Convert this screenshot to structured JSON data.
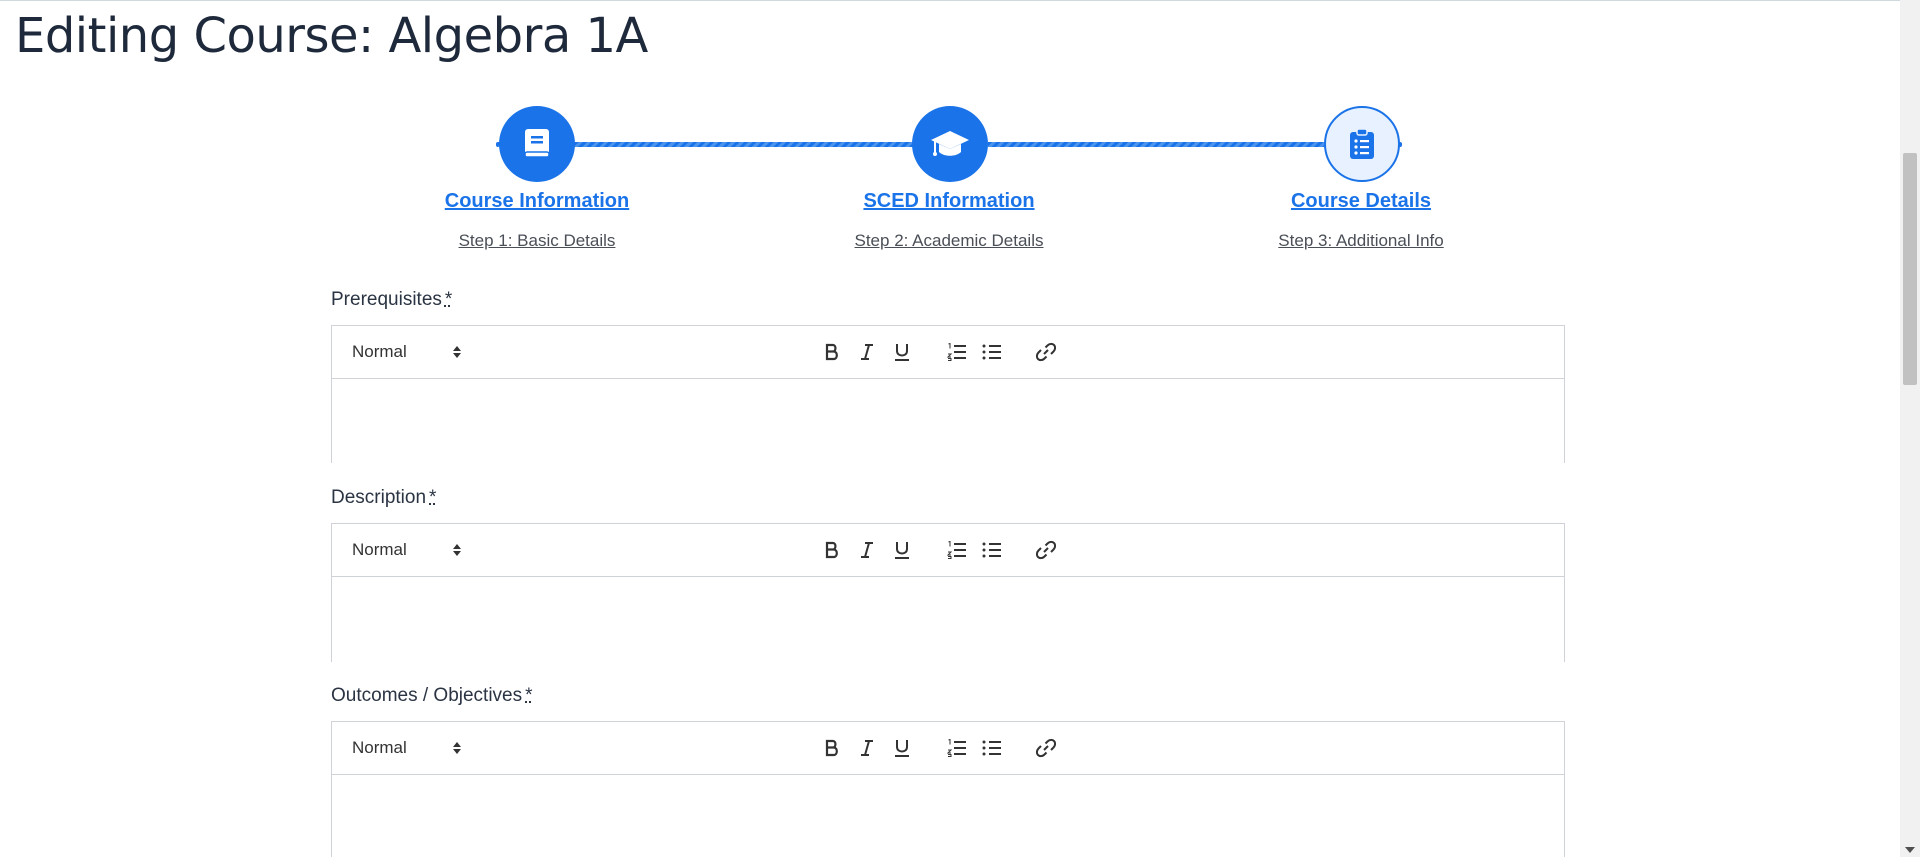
{
  "page": {
    "title": "Editing Course: Algebra 1A"
  },
  "stepper": {
    "steps": [
      {
        "title": "Course Information",
        "subtitle": "Step 1: Basic Details",
        "icon": "book-icon",
        "state": "completed"
      },
      {
        "title": "SCED Information",
        "subtitle": "Step 2: Academic Details",
        "icon": "graduation-cap-icon",
        "state": "completed"
      },
      {
        "title": "Course Details",
        "subtitle": "Step 3: Additional Info",
        "icon": "clipboard-list-icon",
        "state": "current"
      }
    ],
    "accent_color": "#1a73e8"
  },
  "form": {
    "required_marker": "*",
    "fields": [
      {
        "label": "Prerequisites",
        "format_value": "Normal",
        "content": ""
      },
      {
        "label": "Description",
        "format_value": "Normal",
        "content": ""
      },
      {
        "label": "Outcomes / Objectives",
        "format_value": "Normal",
        "content": ""
      }
    ],
    "toolbar_icons": [
      "bold-icon",
      "italic-icon",
      "underline-icon",
      "ordered-list-icon",
      "bullet-list-icon",
      "link-icon"
    ]
  }
}
